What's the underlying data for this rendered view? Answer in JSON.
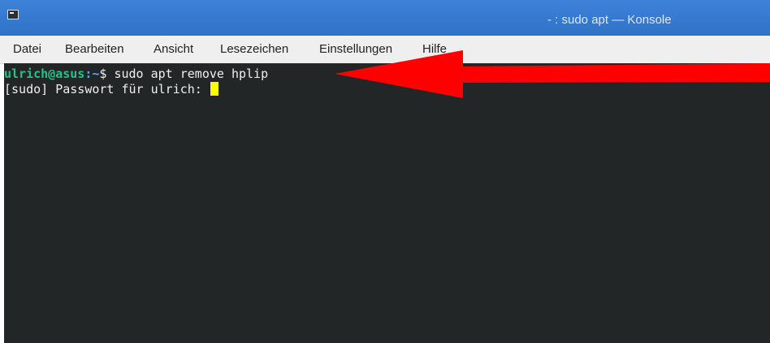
{
  "window": {
    "title": "- : sudo apt — Konsole",
    "app_icon": "terminal-icon"
  },
  "menu": {
    "items": [
      {
        "label": "Datei"
      },
      {
        "label": "Bearbeiten"
      },
      {
        "label": "Ansicht"
      },
      {
        "label": "Lesezeichen"
      },
      {
        "label": "Einstellungen"
      },
      {
        "label": "Hilfe"
      }
    ]
  },
  "terminal": {
    "prompt_user": "ulrich@asus",
    "prompt_colon": ":",
    "prompt_path": "~",
    "prompt_symbol": "$",
    "command": " sudo apt remove hplip",
    "password_prompt": "[sudo] Passwort für ulrich: "
  },
  "colors": {
    "titlebar": "#2f73c9",
    "menubar": "#efefef",
    "terminal_background": "#232627",
    "prompt_user": "#27c087",
    "prompt_path": "#58a6ff",
    "cursor": "#ffff00",
    "annotation_arrow": "#ff0000"
  },
  "annotation": {
    "icon": "red-arrow-icon"
  }
}
